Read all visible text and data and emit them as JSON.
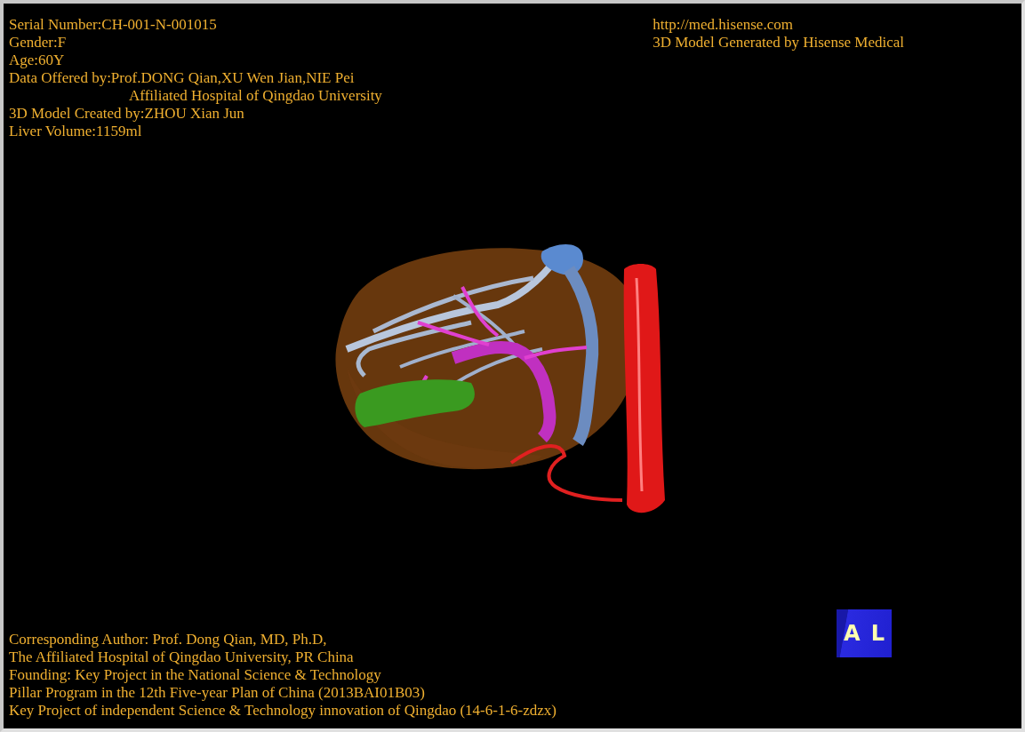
{
  "header_left": [
    {
      "text": "Serial Number:CH-001-N-001015",
      "kind": "line"
    },
    {
      "text": "Gender:F",
      "kind": "line"
    },
    {
      "text": "Age:60Y",
      "kind": "line"
    },
    {
      "text": "Data Offered by:Prof.DONG Qian,XU Wen Jian,NIE Pei",
      "kind": "line"
    },
    {
      "text": "Affiliated Hospital of Qingdao University",
      "kind": "continuation"
    },
    {
      "text": "3D Model Created by:ZHOU Xian Jun",
      "kind": "line"
    },
    {
      "text": "Liver Volume:1159ml",
      "kind": "line"
    }
  ],
  "header_right": [
    "http://med.hisense.com",
    "3D Model Generated by Hisense Medical"
  ],
  "footer": [
    "Corresponding Author: Prof. Dong Qian, MD, Ph.D,",
    "The Affiliated Hospital of Qingdao University, PR China",
    "Founding: Key Project in the National Science & Technology",
    "Pillar Program in the 12th Five-year Plan of China (2013BAI01B03)",
    "Key Project of independent Science & Technology innovation of Qingdao (14-6-1-6-zdzx)"
  ],
  "orientation_cube": {
    "faces": [
      "A",
      "L"
    ]
  }
}
